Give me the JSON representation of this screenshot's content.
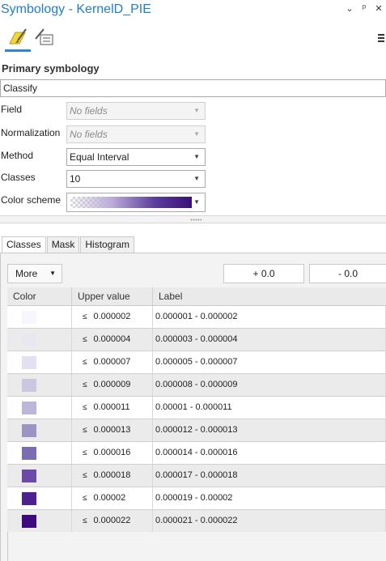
{
  "window": {
    "title": "Symbology - KernelD_PIE",
    "controls": [
      "⌄",
      "ᵖ",
      "✕"
    ]
  },
  "primary_symbology": {
    "heading": "Primary symbology",
    "value": "Classify"
  },
  "fields": {
    "field_label": "Field",
    "field_value": "No fields",
    "normalization_label": "Normalization",
    "normalization_value": "No fields",
    "method_label": "Method",
    "method_value": "Equal Interval",
    "classes_label": "Classes",
    "classes_value": "10",
    "color_scheme_label": "Color scheme"
  },
  "tabs": [
    {
      "label": "Classes",
      "active": true
    },
    {
      "label": "Mask",
      "active": false
    },
    {
      "label": "Histogram",
      "active": false
    }
  ],
  "toolbar": {
    "more_label": "More",
    "plus_label": "+ 0.0",
    "minus_label": "- 0.0"
  },
  "table": {
    "headers": [
      "Color",
      "Upper value",
      "Label"
    ],
    "le_symbol": "≤",
    "rows": [
      {
        "color": "#f7f6fb",
        "upper": "0.000002",
        "label": "0.000001 - 0.000002"
      },
      {
        "color": "#e9e7f2",
        "upper": "0.000004",
        "label": "0.000003 - 0.000004"
      },
      {
        "color": "#e3e0ef",
        "upper": "0.000007",
        "label": "0.000005 - 0.000007"
      },
      {
        "color": "#cbc7e1",
        "upper": "0.000009",
        "label": "0.000008 - 0.000009"
      },
      {
        "color": "#bcb6da",
        "upper": "0.000011",
        "label": "0.00001 - 0.000011"
      },
      {
        "color": "#9d94c6",
        "upper": "0.000013",
        "label": "0.000012 - 0.000013"
      },
      {
        "color": "#7c6ab2",
        "upper": "0.000016",
        "label": "0.000014 - 0.000016"
      },
      {
        "color": "#6a4aa6",
        "upper": "0.000018",
        "label": "0.000017 - 0.000018"
      },
      {
        "color": "#4f2190",
        "upper": "0.00002",
        "label": "0.000019 - 0.00002"
      },
      {
        "color": "#3e0a7e",
        "upper": "0.000022",
        "label": "0.000021 - 0.000022"
      }
    ]
  }
}
